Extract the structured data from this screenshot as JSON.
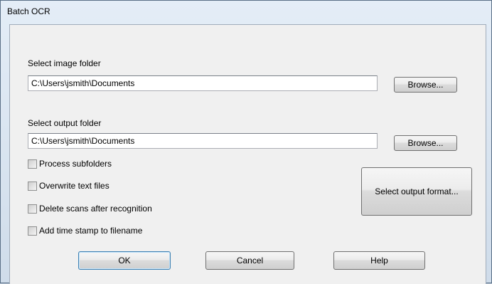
{
  "window": {
    "title": "Batch OCR"
  },
  "image_folder": {
    "label": "Select image folder",
    "value": "C:\\Users\\jsmith\\Documents",
    "browse_label": "Browse..."
  },
  "output_folder": {
    "label": "Select output folder",
    "value": "C:\\Users\\jsmith\\Documents",
    "browse_label": "Browse..."
  },
  "options": [
    {
      "label": "Process subfolders",
      "checked": false
    },
    {
      "label": "Overwrite text files",
      "checked": false
    },
    {
      "label": "Delete scans after recognition",
      "checked": false
    },
    {
      "label": "Add time stamp to filename",
      "checked": false
    }
  ],
  "format_button": {
    "label": "Select output format..."
  },
  "footer": {
    "ok_label": "OK",
    "cancel_label": "Cancel",
    "help_label": "Help"
  }
}
